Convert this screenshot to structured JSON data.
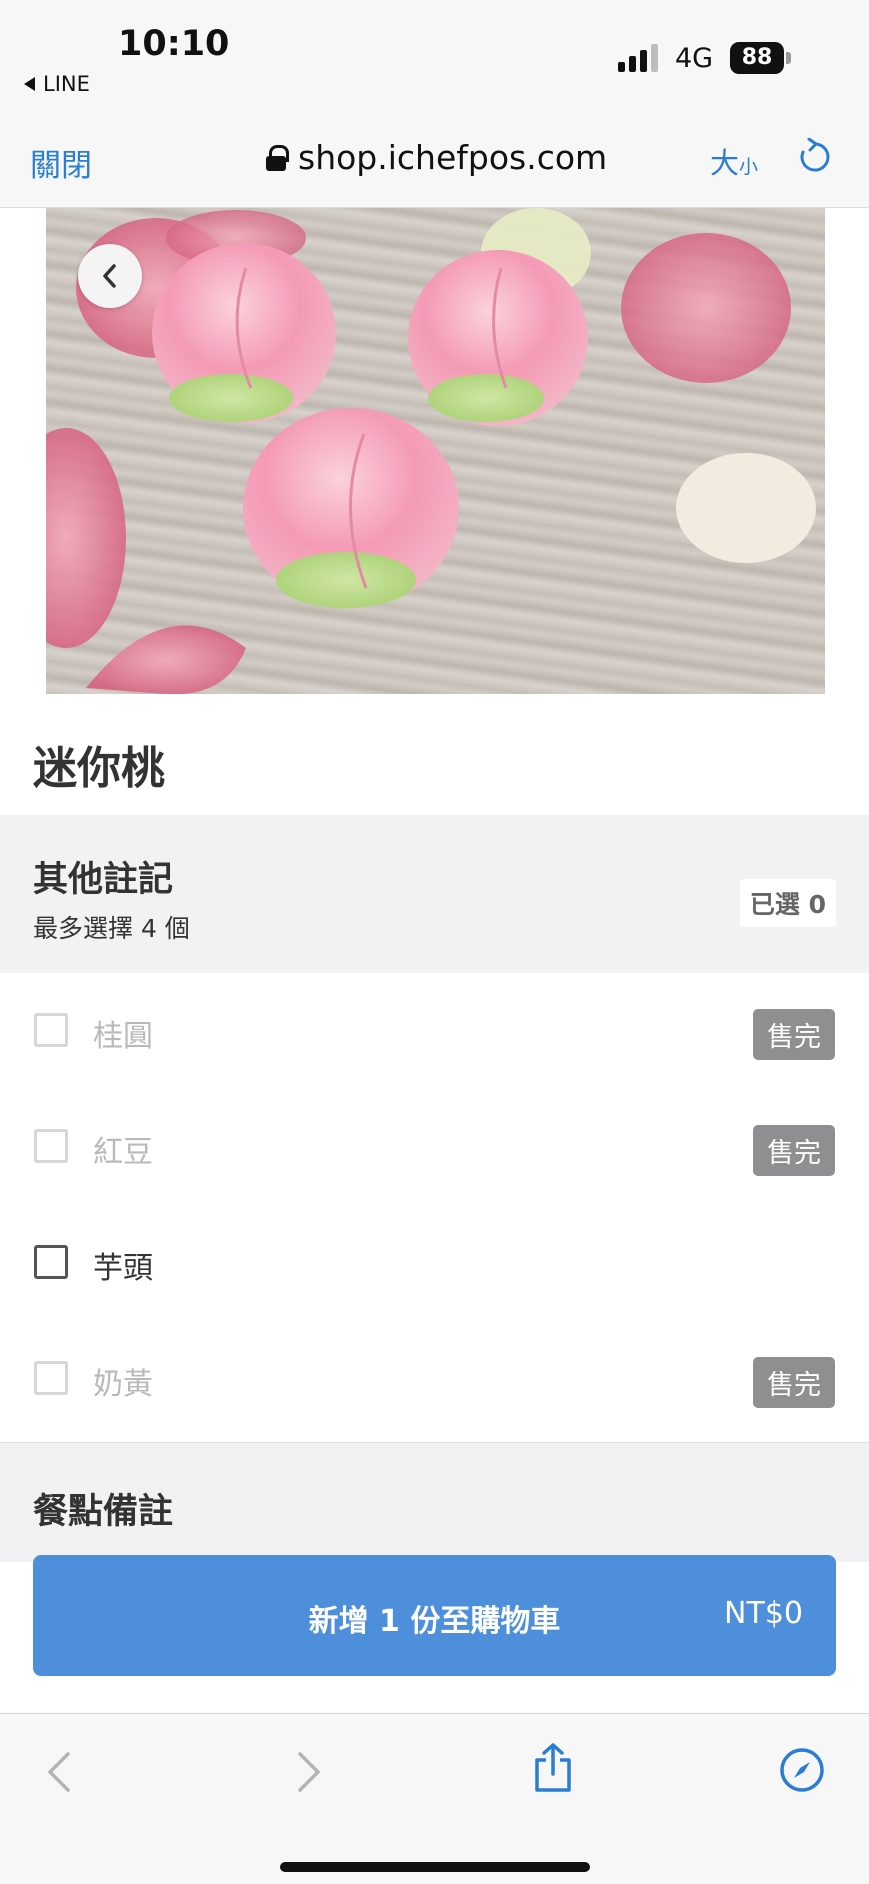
{
  "status_bar": {
    "time": "10:10",
    "back_app": "LINE",
    "network": "4G",
    "battery": "88"
  },
  "browser": {
    "close_label": "關閉",
    "url": "shop.ichefpos.com",
    "text_size_big": "大",
    "text_size_small": "小"
  },
  "product": {
    "title": "迷你桃",
    "image_alt": "peach-shaped buns"
  },
  "options_section": {
    "title": "其他註記",
    "subtitle": "最多選擇 4 個",
    "selected_count": "已選 0",
    "items": [
      {
        "label": "桂圓",
        "badge": "售完",
        "disabled": true
      },
      {
        "label": "紅豆",
        "badge": "售完",
        "disabled": true
      },
      {
        "label": "芋頭",
        "badge": "",
        "disabled": false
      },
      {
        "label": "奶黃",
        "badge": "售完",
        "disabled": true
      }
    ]
  },
  "note_section": {
    "title": "餐點備註"
  },
  "cart_button": {
    "label": "新增 1 份至購物車",
    "price": "NT$0"
  },
  "colors": {
    "accent": "#2a7dd4",
    "button": "#4e8fdb",
    "soldout_badge": "#8f8f91"
  }
}
